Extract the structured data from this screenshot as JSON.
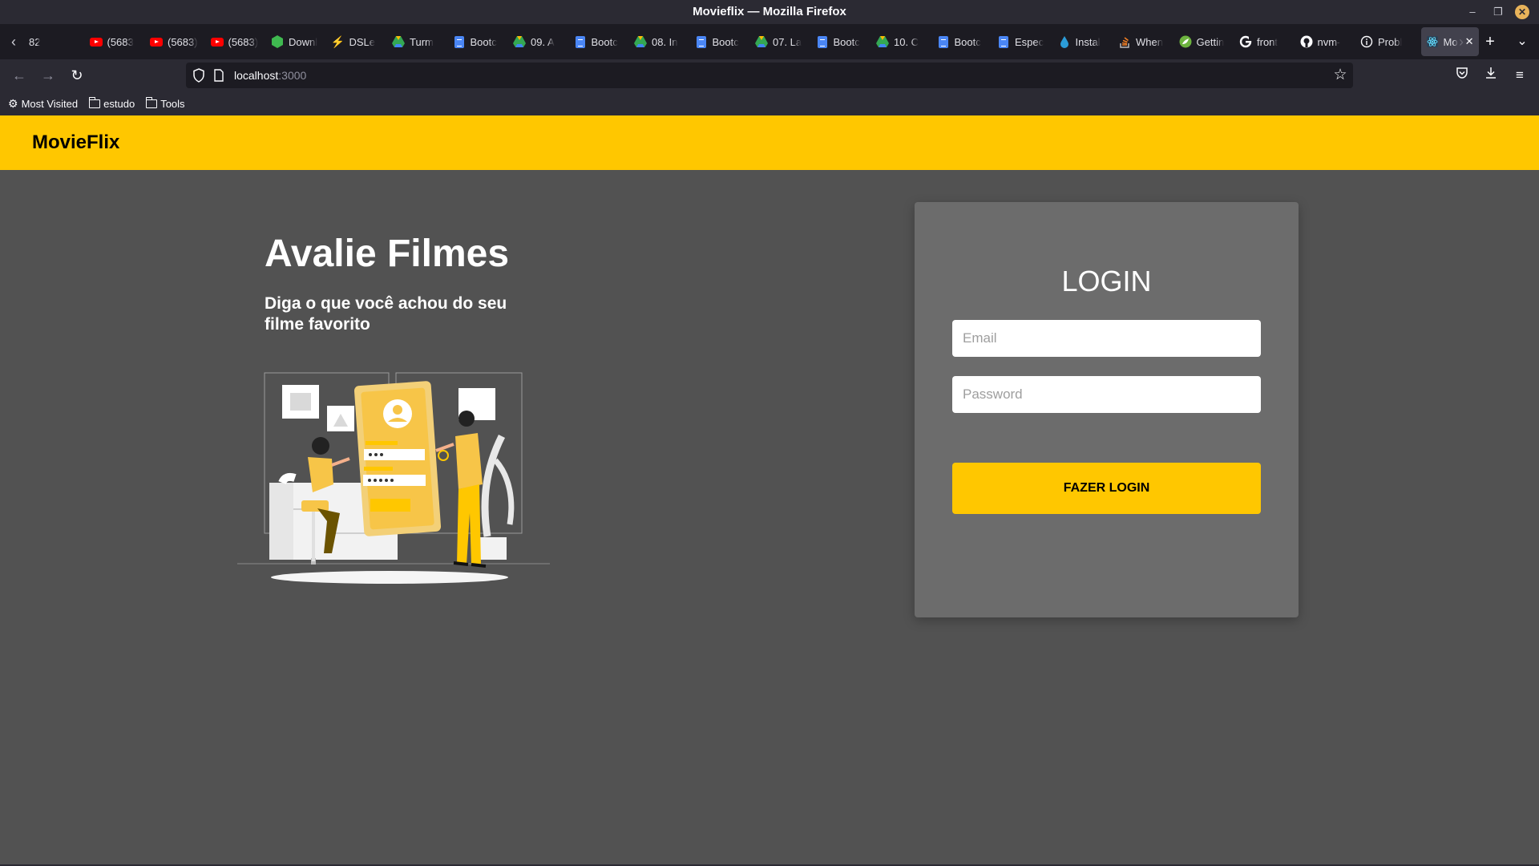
{
  "window": {
    "title": "Movieflix — Mozilla Firefox"
  },
  "tabs": [
    {
      "label": "82",
      "icon": "none-icon"
    },
    {
      "label": "(5683",
      "icon": "youtube-icon"
    },
    {
      "label": "(5683)",
      "icon": "youtube-icon"
    },
    {
      "label": "(5683)",
      "icon": "youtube-icon"
    },
    {
      "label": "Downl",
      "icon": "green-shield-icon"
    },
    {
      "label": "DSLe",
      "icon": "lightning-icon"
    },
    {
      "label": "Turm",
      "icon": "drive-icon"
    },
    {
      "label": "Bootc",
      "icon": "docs-icon"
    },
    {
      "label": "09. A",
      "icon": "drive-icon"
    },
    {
      "label": "Bootc",
      "icon": "docs-icon"
    },
    {
      "label": "08. In",
      "icon": "drive-icon"
    },
    {
      "label": "Bootc",
      "icon": "docs-icon"
    },
    {
      "label": "07. La",
      "icon": "drive-icon"
    },
    {
      "label": "Bootc",
      "icon": "docs-icon"
    },
    {
      "label": "10. C",
      "icon": "drive-icon"
    },
    {
      "label": "Bootc",
      "icon": "docs-icon"
    },
    {
      "label": "Espec",
      "icon": "docs-icon"
    },
    {
      "label": "Instal",
      "icon": "drop-icon"
    },
    {
      "label": "When",
      "icon": "stackoverflow-icon"
    },
    {
      "label": "Gettin",
      "icon": "spring-icon"
    },
    {
      "label": "front",
      "icon": "google-icon"
    },
    {
      "label": "nvm-",
      "icon": "github-icon"
    },
    {
      "label": "Probl",
      "icon": "info-icon"
    },
    {
      "label": "Mo",
      "icon": "react-icon",
      "active": true
    }
  ],
  "nav": {
    "url_host": "localhost",
    "url_port": ":3000"
  },
  "bookmarks": {
    "most_visited": "Most Visited",
    "estudo": "estudo",
    "tools": "Tools"
  },
  "site": {
    "brand": "MovieFlix",
    "hero_title": "Avalie Filmes",
    "hero_subtitle": "Diga o que você achou do seu filme favorito"
  },
  "login": {
    "title": "LOGIN",
    "email_placeholder": "Email",
    "password_placeholder": "Password",
    "submit_label": "FAZER LOGIN"
  },
  "colors": {
    "accent": "#ffc700",
    "page_bg": "#525252",
    "card_bg": "#6c6c6c"
  }
}
